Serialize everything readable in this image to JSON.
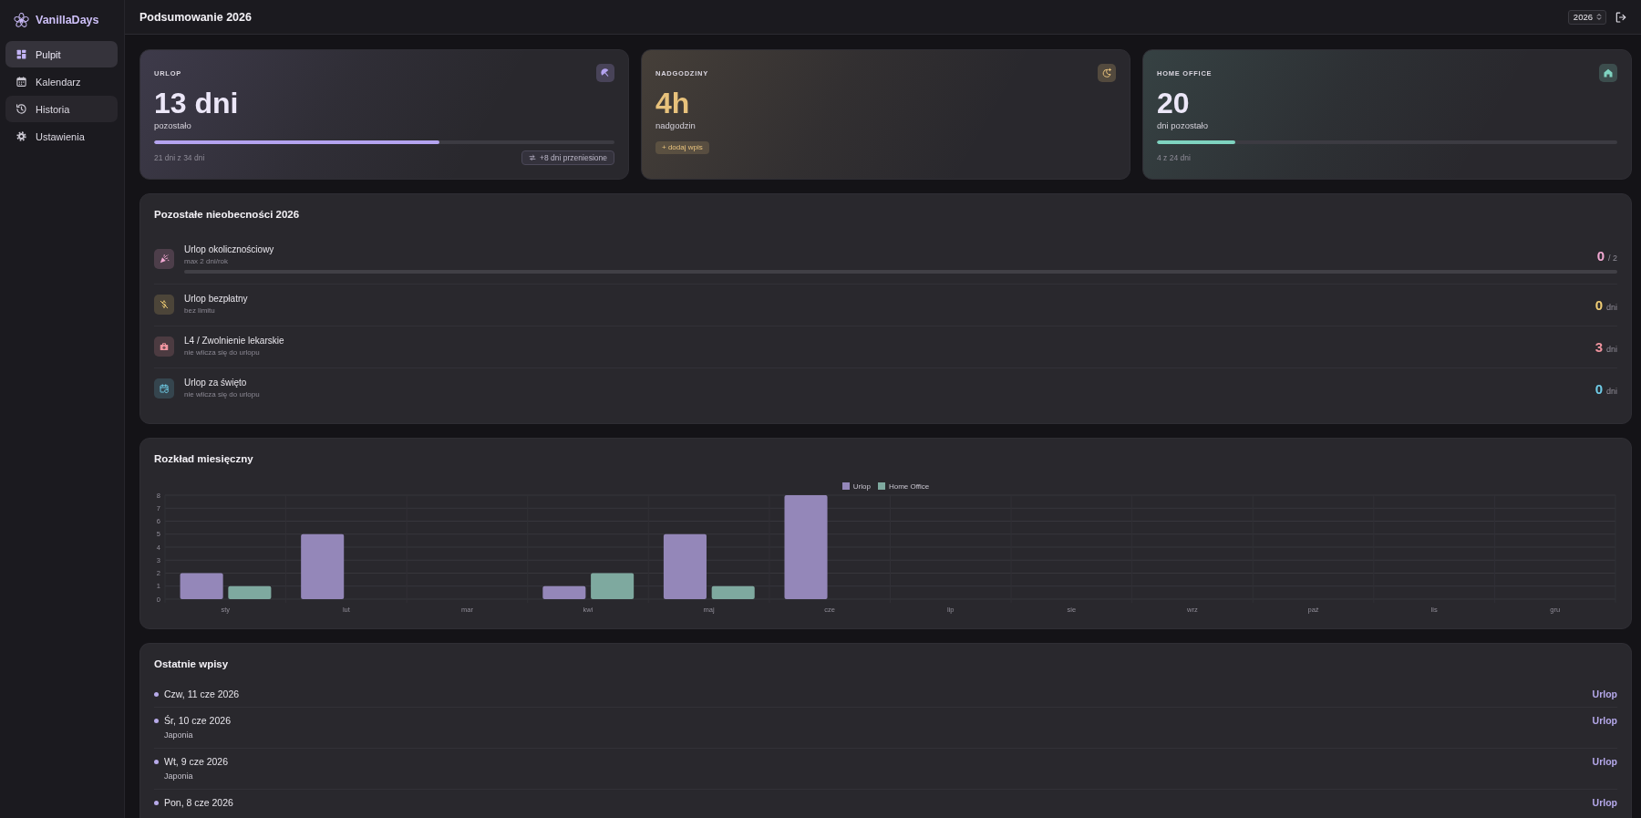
{
  "sidebar": {
    "brand": "VanillaDays",
    "items": [
      {
        "label": "Pulpit",
        "selected": true,
        "hovered": false
      },
      {
        "label": "Kalendarz",
        "selected": false,
        "hovered": false
      },
      {
        "label": "Historia",
        "selected": false,
        "hovered": true
      },
      {
        "label": "Ustawienia",
        "selected": false,
        "hovered": false
      }
    ]
  },
  "header": {
    "title": "Podsumowanie 2026",
    "year": "2026"
  },
  "cards": [
    {
      "kind": "balance",
      "label": "URLOP",
      "value": "13 dni",
      "caption": "pozostało",
      "level": 0.62,
      "footer": "21 dni z 34 dni",
      "badge": "+8 dni przeniesione",
      "color": "#b4a3f0"
    },
    {
      "kind": "overtime",
      "label": "NADGODZINY",
      "value": "4h",
      "caption": "nadgodzin",
      "action": "+ dodaj wpis",
      "color": "#e8c27c"
    },
    {
      "kind": "balance",
      "label": "HOME OFFICE",
      "value": "20",
      "caption": "dni pozostało",
      "level": 0.17,
      "footer": "4 z 24 dni",
      "color": "#7fd3c0"
    }
  ],
  "absences": {
    "title": "Pozostałe nieobecności 2026",
    "items": [
      {
        "kind": "limited",
        "name": "Urlop okolicznościowy",
        "note": "max 2 dni/rok",
        "value": "0",
        "unit": "/ 2",
        "color": "#f2a8d2"
      },
      {
        "kind": "count",
        "name": "Urlop bezpłatny",
        "note": "bez limitu",
        "value": "0",
        "unit": "dni",
        "color": "#f0cd74"
      },
      {
        "kind": "count",
        "name": "L4 / Zwolnienie lekarskie",
        "note": "nie wlicza się do urlopu",
        "value": "3",
        "unit": "dni",
        "color": "#f0949f"
      },
      {
        "kind": "count",
        "name": "Urlop za święto",
        "note": "nie wlicza się do urlopu",
        "value": "0",
        "unit": "dni",
        "color": "#70cde8"
      }
    ]
  },
  "monthly": {
    "title": "Rozkład miesięczny",
    "chart_data": {
      "type": "bar",
      "categories": [
        "sty",
        "lut",
        "mar",
        "kwi",
        "maj",
        "cze",
        "lip",
        "sie",
        "wrz",
        "paź",
        "lis",
        "gru"
      ],
      "series": [
        {
          "name": "Urlop",
          "color": "#9487b9",
          "values": [
            2,
            5,
            0,
            1,
            5,
            8,
            0,
            0,
            0,
            0,
            0,
            0
          ]
        },
        {
          "name": "Home Office",
          "color": "#7ea99f",
          "values": [
            1,
            0,
            0,
            2,
            1,
            0,
            0,
            0,
            0,
            0,
            0,
            0
          ]
        }
      ],
      "ylim": [
        0,
        8
      ],
      "yticks": [
        0,
        1,
        2,
        3,
        4,
        5,
        6,
        7,
        8
      ],
      "grid": true,
      "legend": "top"
    }
  },
  "recent": {
    "title": "Ostatnie wpisy",
    "entries": [
      {
        "date": "Czw, 11 cze 2026",
        "type": "Urlop"
      },
      {
        "date": "Śr, 10 cze 2026",
        "note": "Japonia",
        "type": "Urlop"
      },
      {
        "date": "Wt, 9 cze 2026",
        "note": "Japonia",
        "type": "Urlop"
      },
      {
        "date": "Pon, 8 cze 2026",
        "type": "Urlop"
      }
    ]
  }
}
